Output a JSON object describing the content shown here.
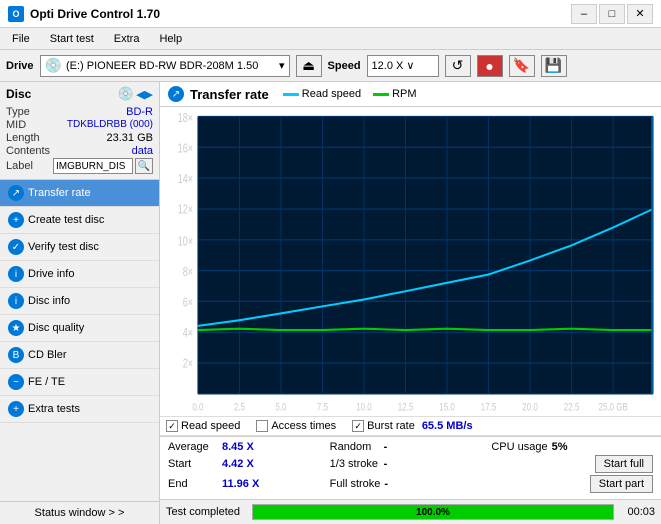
{
  "titlebar": {
    "title": "Opti Drive Control 1.70",
    "min": "–",
    "max": "□",
    "close": "✕"
  },
  "menu": {
    "items": [
      "File",
      "Start test",
      "Extra",
      "Help"
    ]
  },
  "drivebar": {
    "label": "Drive",
    "drive_display": "(E:)  PIONEER BD-RW   BDR-208M 1.50",
    "speed_label": "Speed",
    "speed_value": "12.0 X ∨"
  },
  "disc": {
    "label": "Disc",
    "type_label": "Type",
    "type_value": "BD-R",
    "mid_label": "MID",
    "mid_value": "TDKBLDRBB (000)",
    "length_label": "Length",
    "length_value": "23.31 GB",
    "contents_label": "Contents",
    "contents_value": "data",
    "label_label": "Label",
    "label_value": "IMGBURN_DIS"
  },
  "nav": {
    "items": [
      {
        "id": "transfer-rate",
        "label": "Transfer rate",
        "active": true
      },
      {
        "id": "create-test-disc",
        "label": "Create test disc",
        "active": false
      },
      {
        "id": "verify-test-disc",
        "label": "Verify test disc",
        "active": false
      },
      {
        "id": "drive-info",
        "label": "Drive info",
        "active": false
      },
      {
        "id": "disc-info",
        "label": "Disc info",
        "active": false
      },
      {
        "id": "disc-quality",
        "label": "Disc quality",
        "active": false
      },
      {
        "id": "cd-bler",
        "label": "CD Bler",
        "active": false
      },
      {
        "id": "fe-te",
        "label": "FE / TE",
        "active": false
      },
      {
        "id": "extra-tests",
        "label": "Extra tests",
        "active": false
      }
    ],
    "status_window": "Status window > >"
  },
  "chart": {
    "title": "Transfer rate",
    "legend": {
      "read_speed_label": "Read speed",
      "rpm_label": "RPM"
    },
    "y_axis_labels": [
      "18×",
      "16×",
      "14×",
      "12×",
      "10×",
      "8×",
      "6×",
      "4×",
      "2×"
    ],
    "x_axis_labels": [
      "0.0",
      "2.5",
      "5.0",
      "7.5",
      "10.0",
      "12.5",
      "15.0",
      "17.5",
      "20.0",
      "22.5",
      "25.0 GB"
    ],
    "checkboxes": {
      "read_speed_checked": true,
      "read_speed_label": "Read speed",
      "access_times_checked": false,
      "access_times_label": "Access times",
      "burst_rate_checked": true,
      "burst_rate_label": "Burst rate",
      "burst_rate_value": "65.5 MB/s"
    }
  },
  "stats": {
    "average_label": "Average",
    "average_value": "8.45 X",
    "random_label": "Random",
    "random_value": "-",
    "cpu_label": "CPU usage",
    "cpu_value": "5%",
    "start_label": "Start",
    "start_value": "4.42 X",
    "stroke_1_3_label": "1/3 stroke",
    "stroke_1_3_value": "-",
    "start_full_label": "Start full",
    "end_label": "End",
    "end_value": "11.96 X",
    "full_stroke_label": "Full stroke",
    "full_stroke_value": "-",
    "start_part_label": "Start part"
  },
  "progress": {
    "status_text": "Test completed",
    "percent": 100,
    "percent_label": "100.0%",
    "time": "00:03"
  }
}
